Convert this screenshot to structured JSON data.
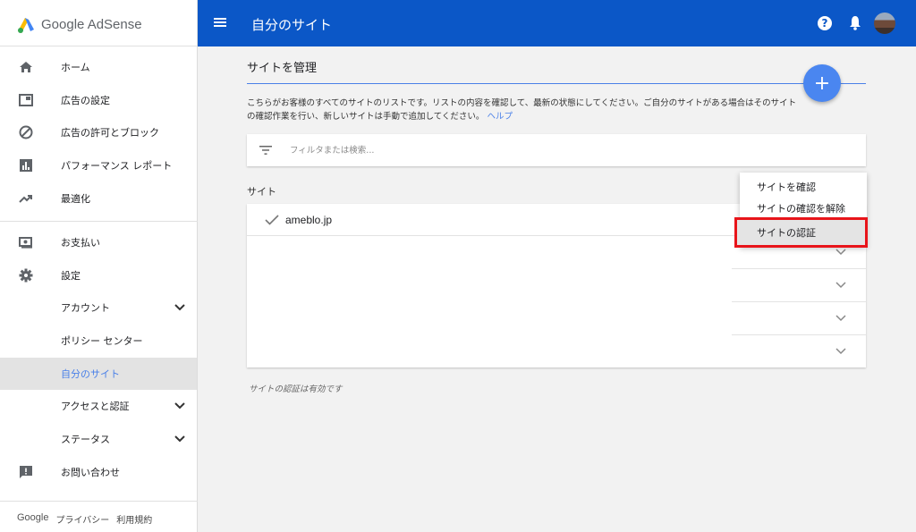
{
  "sidebar": {
    "brand": "Google AdSense",
    "items": [
      {
        "label": "ホーム"
      },
      {
        "label": "広告の設定"
      },
      {
        "label": "広告の許可とブロック"
      },
      {
        "label": "パフォーマンス レポート"
      },
      {
        "label": "最適化"
      },
      {
        "label": "お支払い"
      },
      {
        "label": "設定"
      },
      {
        "label": "アカウント"
      },
      {
        "label": "ポリシー センター"
      },
      {
        "label": "自分のサイト"
      },
      {
        "label": "アクセスと認証"
      },
      {
        "label": "ステータス"
      },
      {
        "label": "お問い合わせ"
      }
    ],
    "footer": {
      "google": "Google",
      "privacy": "プライバシー",
      "terms": "利用規約"
    }
  },
  "header": {
    "title": "自分のサイト",
    "help": "?"
  },
  "main": {
    "page_title": "サイトを管理",
    "fab": "+",
    "description": "こちらがお客様のすべてのサイトのリストです。リストの内容を確認して、最新の状態にしてください。ご自分のサイトがある場合はそのサイトの確認作業を行い、新しいサイトは手動で追加してください。",
    "help_link": "ヘルプ",
    "filter_placeholder": "フィルタまたは検索...",
    "sites_header": "サイト",
    "sites": [
      {
        "name": "ameblo.jp"
      }
    ],
    "footnote": "サイトの認証は有効です"
  },
  "context_menu": {
    "items": [
      "サイトを確認",
      "サイトの確認を解除",
      "サイトの認証"
    ]
  },
  "colors": {
    "header": "#0b57c7",
    "accent": "#4a80e8",
    "fab": "#4a86f0",
    "highlight_border": "#e8141a"
  }
}
